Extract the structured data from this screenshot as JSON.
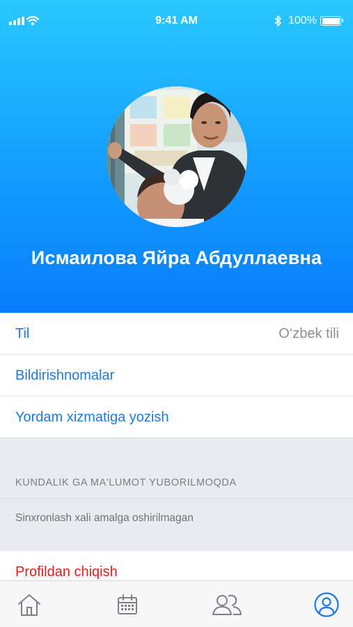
{
  "status_bar": {
    "time": "9:41 AM",
    "battery_percent": "100%",
    "icons": [
      "signal-icon",
      "wifi-icon",
      "bluetooth-icon",
      "battery-icon"
    ]
  },
  "profile": {
    "name": "Исмаилова Яйра Абдуллаевна"
  },
  "settings": {
    "language_label": "Til",
    "language_value": "O‘zbek tili",
    "notifications_label": "Bildirishnomalar",
    "support_label": "Yordam xizmatiga yozish"
  },
  "sync_section": {
    "header": "KUNDALIK GA MA'LUMOT YUBORILMOQDA",
    "note": "Sinxronlash xali amalga oshirilmagan"
  },
  "logout": {
    "label": "Profildan chiqish"
  },
  "tab_bar": {
    "tabs": [
      {
        "icon": "home-icon",
        "active": false
      },
      {
        "icon": "calendar-icon",
        "active": false
      },
      {
        "icon": "users-icon",
        "active": false
      },
      {
        "icon": "profile-icon",
        "active": true
      }
    ]
  },
  "colors": {
    "header_gradient_top": "#29c8ff",
    "header_gradient_bottom": "#087dfb",
    "link_blue": "#1d7ae0",
    "logout_red": "#e01c1c",
    "secondary_gray": "#8e8e93",
    "section_background": "#e8ebf0",
    "tab_inactive": "#7c8189",
    "tab_active": "#1b77e8"
  }
}
